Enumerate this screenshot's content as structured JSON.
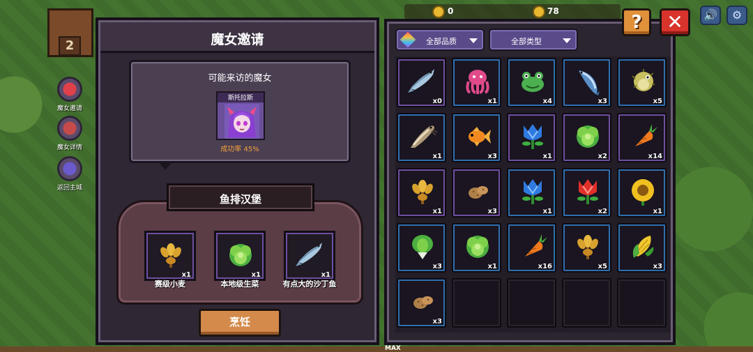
{
  "hud": {
    "house_number": "2",
    "gold_value": "0",
    "gem_value": "78",
    "max_label": "MAX"
  },
  "side_menu": [
    {
      "label": "魔女邀请",
      "icon": "heart-icon"
    },
    {
      "label": "魔女详情",
      "icon": "book-icon"
    },
    {
      "label": "返回主城",
      "icon": "castle-icon"
    }
  ],
  "buttons": {
    "help": "?",
    "close": "✕",
    "sound": "🔊",
    "settings": "⚙"
  },
  "left_panel": {
    "title": "魔女邀请",
    "bubble_title": "可能来访的魔女",
    "witch": {
      "name": "斯托拉斯",
      "success_rate": "成功率 45%"
    },
    "recipe_name": "鱼排汉堡",
    "ingredients": [
      {
        "name": "赛级小麦",
        "qty": "x1",
        "icon": "wheat"
      },
      {
        "name": "本地级生菜",
        "qty": "x1",
        "icon": "lettuce"
      },
      {
        "name": "有点大的沙丁鱼",
        "qty": "x1",
        "icon": "sardine"
      }
    ],
    "cook_button": "烹饪"
  },
  "right_panel": {
    "filter_quality": "全部品质",
    "filter_type": "全部类型",
    "items": [
      {
        "icon": "sardine",
        "qty": "x0",
        "quality": "purple"
      },
      {
        "icon": "octopus",
        "qty": "x1",
        "quality": "blue"
      },
      {
        "icon": "frog",
        "qty": "x4",
        "quality": "blue"
      },
      {
        "icon": "blue-fish",
        "qty": "x3",
        "quality": "blue"
      },
      {
        "icon": "pufferfish",
        "qty": "x5",
        "quality": "blue"
      },
      {
        "icon": "catfish",
        "qty": "x1",
        "quality": "blue"
      },
      {
        "icon": "goldfish",
        "qty": "x3",
        "quality": "blue"
      },
      {
        "icon": "blue-flower",
        "qty": "x1",
        "quality": "purple"
      },
      {
        "icon": "lettuce",
        "qty": "x2",
        "quality": "purple"
      },
      {
        "icon": "carrot",
        "qty": "x14",
        "quality": "purple"
      },
      {
        "icon": "wheat",
        "qty": "x1",
        "quality": "purple"
      },
      {
        "icon": "potato",
        "qty": "x3",
        "quality": "purple"
      },
      {
        "icon": "blue-flower",
        "qty": "x1",
        "quality": "blue"
      },
      {
        "icon": "red-flower",
        "qty": "x2",
        "quality": "blue"
      },
      {
        "icon": "sunflower",
        "qty": "x1",
        "quality": "blue"
      },
      {
        "icon": "bok-choy",
        "qty": "x3",
        "quality": "blue"
      },
      {
        "icon": "lettuce",
        "qty": "x1",
        "quality": "blue"
      },
      {
        "icon": "carrot",
        "qty": "x16",
        "quality": "blue"
      },
      {
        "icon": "wheat",
        "qty": "x5",
        "quality": "blue"
      },
      {
        "icon": "corn",
        "qty": "x3",
        "quality": "blue"
      },
      {
        "icon": "potato",
        "qty": "x3",
        "quality": "blue"
      },
      {
        "icon": "",
        "qty": "",
        "quality": "empty"
      },
      {
        "icon": "",
        "qty": "",
        "quality": "empty"
      },
      {
        "icon": "",
        "qty": "",
        "quality": "empty"
      },
      {
        "icon": "",
        "qty": "",
        "quality": "empty"
      }
    ]
  },
  "colors": {
    "panel_bg": "#2f2733",
    "quality_purple": "#6f4fa0",
    "quality_blue": "#2f6fae",
    "accent_orange": "#d38a4a",
    "success_rate": "#f0a13a",
    "close_red": "#d8342c"
  }
}
